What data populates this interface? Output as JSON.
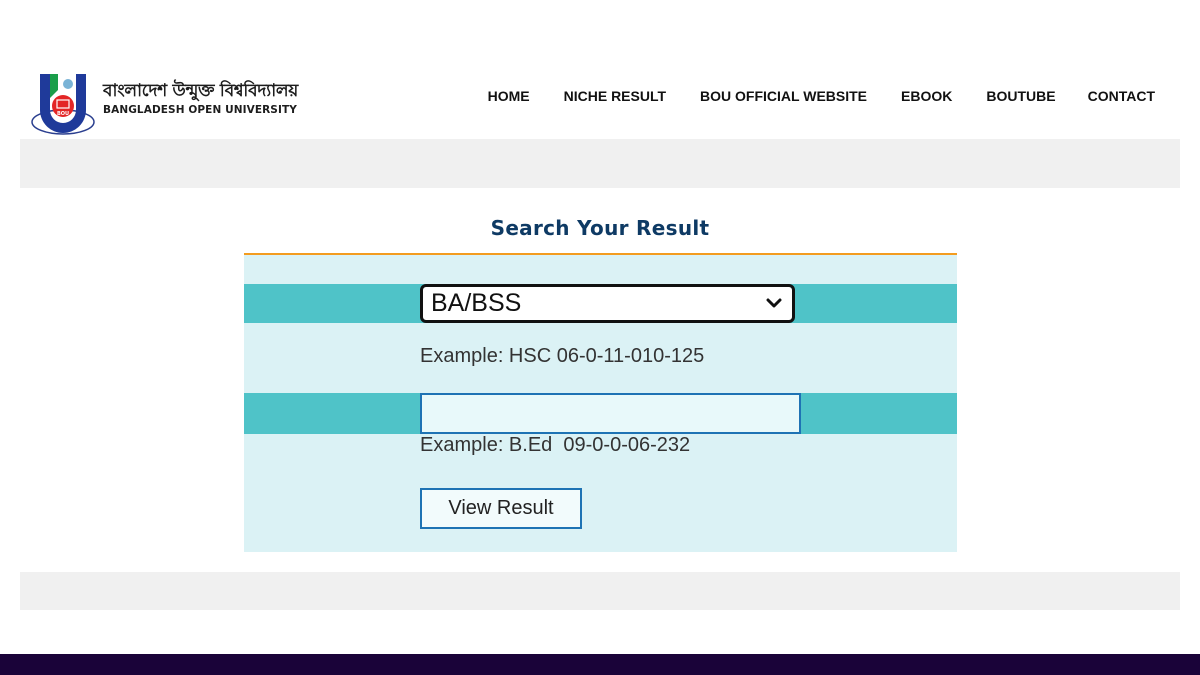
{
  "brand": {
    "name_bn": "বাংলাদেশ উন্মুক্ত বিশ্ববিদ্যালয়",
    "name_en": "BANGLADESH OPEN UNIVERSITY",
    "logo_text": "BOU"
  },
  "nav": {
    "items": [
      {
        "label": "HOME"
      },
      {
        "label": "NICHE RESULT"
      },
      {
        "label": "BOU OFFICIAL WEBSITE"
      },
      {
        "label": "EBOOK"
      },
      {
        "label": "BOUTUBE"
      },
      {
        "label": "CONTACT"
      }
    ]
  },
  "search": {
    "title": "Search Your Result",
    "program_select": {
      "selected": "BA/BSS"
    },
    "example_program": "Example: HSC 06-0-11-010-125",
    "roll_input": {
      "value": "",
      "placeholder": ""
    },
    "example_roll": "Example: B.Ed  09-0-0-06-232",
    "submit_label": "View Result"
  },
  "colors": {
    "title": "#0e3a64",
    "accent_line": "#f39c1f",
    "panel_bg": "#dbf2f5",
    "band": "#4fc3c8",
    "input_border": "#1e73b4",
    "footer": "#1a0339"
  }
}
